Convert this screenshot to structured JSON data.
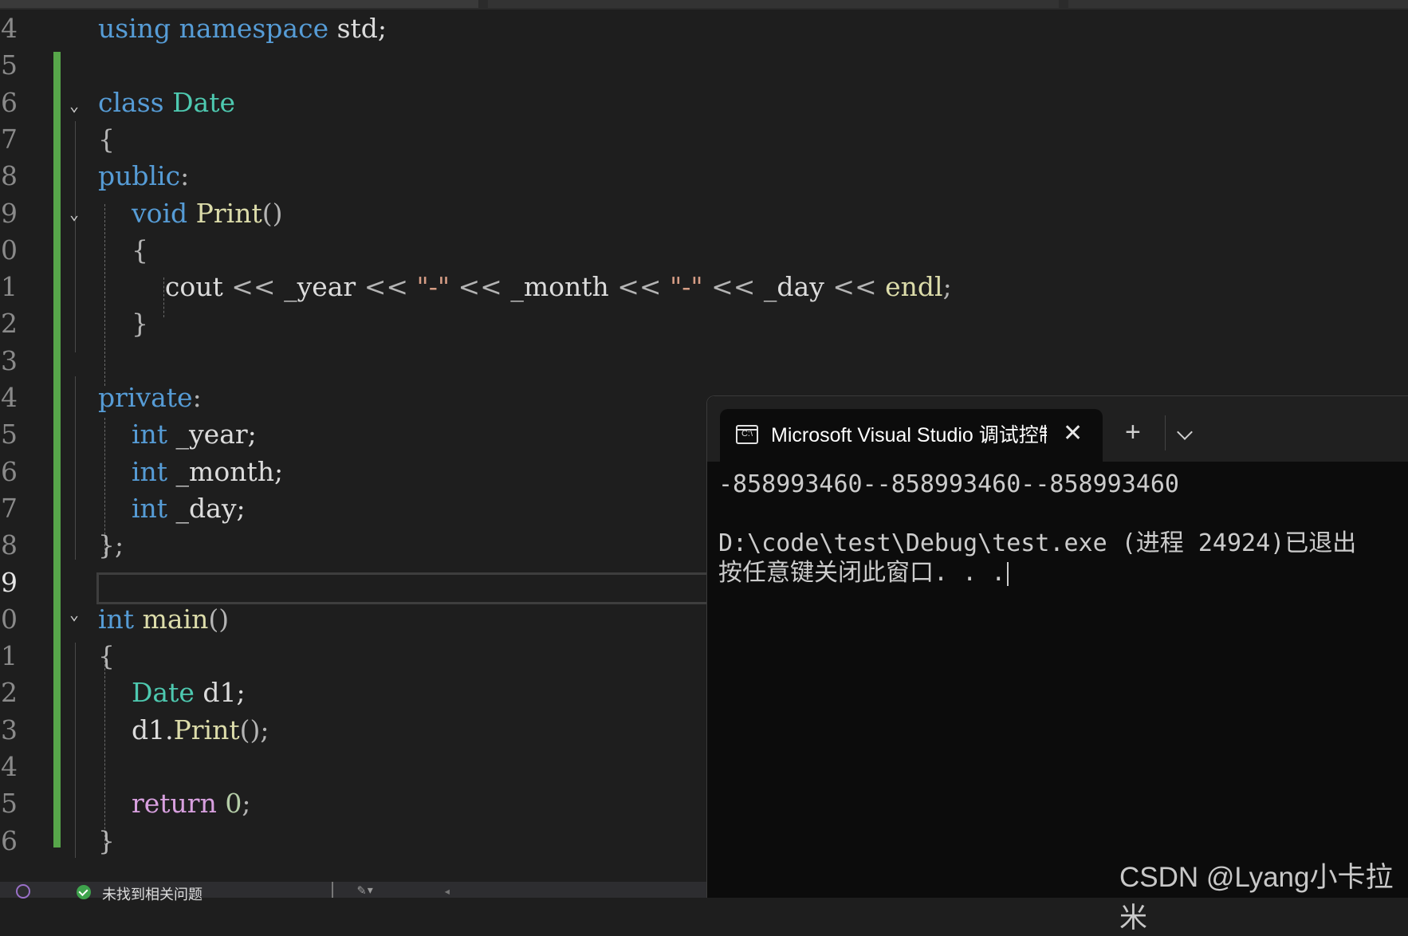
{
  "editor": {
    "lines": [
      {
        "num": "4",
        "tokens": [
          {
            "t": "using",
            "c": "kw"
          },
          {
            "t": " ",
            "c": "var"
          },
          {
            "t": "namespace",
            "c": "kw"
          },
          {
            "t": " std;",
            "c": "var"
          }
        ]
      },
      {
        "num": "5",
        "tokens": []
      },
      {
        "num": "6",
        "tokens": [
          {
            "t": "class",
            "c": "kw"
          },
          {
            "t": " ",
            "c": "var"
          },
          {
            "t": "Date",
            "c": "ty"
          }
        ]
      },
      {
        "num": "7",
        "tokens": [
          {
            "t": "{",
            "c": "punc"
          }
        ]
      },
      {
        "num": "8",
        "tokens": [
          {
            "t": "public",
            "c": "kw"
          },
          {
            "t": ":",
            "c": "punc"
          }
        ]
      },
      {
        "num": "9",
        "tokens": [
          {
            "t": "    ",
            "c": "var"
          },
          {
            "t": "void",
            "c": "kw"
          },
          {
            "t": " ",
            "c": "var"
          },
          {
            "t": "Print",
            "c": "fn"
          },
          {
            "t": "()",
            "c": "punc"
          }
        ]
      },
      {
        "num": "0",
        "tokens": [
          {
            "t": "    {",
            "c": "punc"
          }
        ]
      },
      {
        "num": "1",
        "tokens": [
          {
            "t": "        cout ",
            "c": "var"
          },
          {
            "t": "<<",
            "c": "punc"
          },
          {
            "t": " _year ",
            "c": "var"
          },
          {
            "t": "<<",
            "c": "punc"
          },
          {
            "t": " ",
            "c": "var"
          },
          {
            "t": "\"-\"",
            "c": "str"
          },
          {
            "t": " ",
            "c": "var"
          },
          {
            "t": "<<",
            "c": "punc"
          },
          {
            "t": " _month ",
            "c": "var"
          },
          {
            "t": "<<",
            "c": "punc"
          },
          {
            "t": " ",
            "c": "var"
          },
          {
            "t": "\"-\"",
            "c": "str"
          },
          {
            "t": " ",
            "c": "var"
          },
          {
            "t": "<<",
            "c": "punc"
          },
          {
            "t": " _day ",
            "c": "var"
          },
          {
            "t": "<<",
            "c": "punc"
          },
          {
            "t": " ",
            "c": "var"
          },
          {
            "t": "endl",
            "c": "fn"
          },
          {
            "t": ";",
            "c": "punc"
          }
        ]
      },
      {
        "num": "2",
        "tokens": [
          {
            "t": "    }",
            "c": "punc"
          }
        ]
      },
      {
        "num": "3",
        "tokens": []
      },
      {
        "num": "4",
        "tokens": [
          {
            "t": "private",
            "c": "kw"
          },
          {
            "t": ":",
            "c": "punc"
          }
        ]
      },
      {
        "num": "5",
        "tokens": [
          {
            "t": "    ",
            "c": "var"
          },
          {
            "t": "int",
            "c": "kw"
          },
          {
            "t": " _year;",
            "c": "var"
          }
        ]
      },
      {
        "num": "6",
        "tokens": [
          {
            "t": "    ",
            "c": "var"
          },
          {
            "t": "int",
            "c": "kw"
          },
          {
            "t": " _month;",
            "c": "var"
          }
        ]
      },
      {
        "num": "7",
        "tokens": [
          {
            "t": "    ",
            "c": "var"
          },
          {
            "t": "int",
            "c": "kw"
          },
          {
            "t": " _day;",
            "c": "var"
          }
        ]
      },
      {
        "num": "8",
        "tokens": [
          {
            "t": "};",
            "c": "punc"
          }
        ]
      },
      {
        "num": "9",
        "tokens": []
      },
      {
        "num": "0",
        "tokens": [
          {
            "t": "int",
            "c": "kw"
          },
          {
            "t": " main",
            "c": "fn"
          },
          {
            "t": "()",
            "c": "punc"
          }
        ]
      },
      {
        "num": "1",
        "tokens": [
          {
            "t": "{",
            "c": "punc"
          }
        ]
      },
      {
        "num": "2",
        "tokens": [
          {
            "t": "    ",
            "c": "var"
          },
          {
            "t": "Date",
            "c": "ty"
          },
          {
            "t": " d1;",
            "c": "var"
          }
        ]
      },
      {
        "num": "3",
        "tokens": [
          {
            "t": "    d1.",
            "c": "var"
          },
          {
            "t": "Print",
            "c": "fn"
          },
          {
            "t": "();",
            "c": "punc"
          }
        ]
      },
      {
        "num": "4",
        "tokens": []
      },
      {
        "num": "5",
        "tokens": [
          {
            "t": "    ",
            "c": "var"
          },
          {
            "t": "return",
            "c": "ctl"
          },
          {
            "t": " ",
            "c": "var"
          },
          {
            "t": "0",
            "c": "num"
          },
          {
            "t": ";",
            "c": "punc"
          }
        ]
      },
      {
        "num": "6",
        "tokens": [
          {
            "t": "}",
            "c": "punc"
          }
        ]
      }
    ],
    "active_line_index": 15
  },
  "statusbar": {
    "issues_text": "未找到相关问题"
  },
  "terminal": {
    "tab_icon_label": "C:\\",
    "tab_title": "Microsoft Visual Studio 调试控制台",
    "close_glyph": "✕",
    "new_tab_glyph": "+",
    "output": [
      "-858993460--858993460--858993460",
      "",
      "D:\\code\\test\\Debug\\test.exe (进程 24924)已退出",
      "按任意键关闭此窗口. . ."
    ]
  },
  "watermark": "CSDN @Lyang小卡拉米"
}
